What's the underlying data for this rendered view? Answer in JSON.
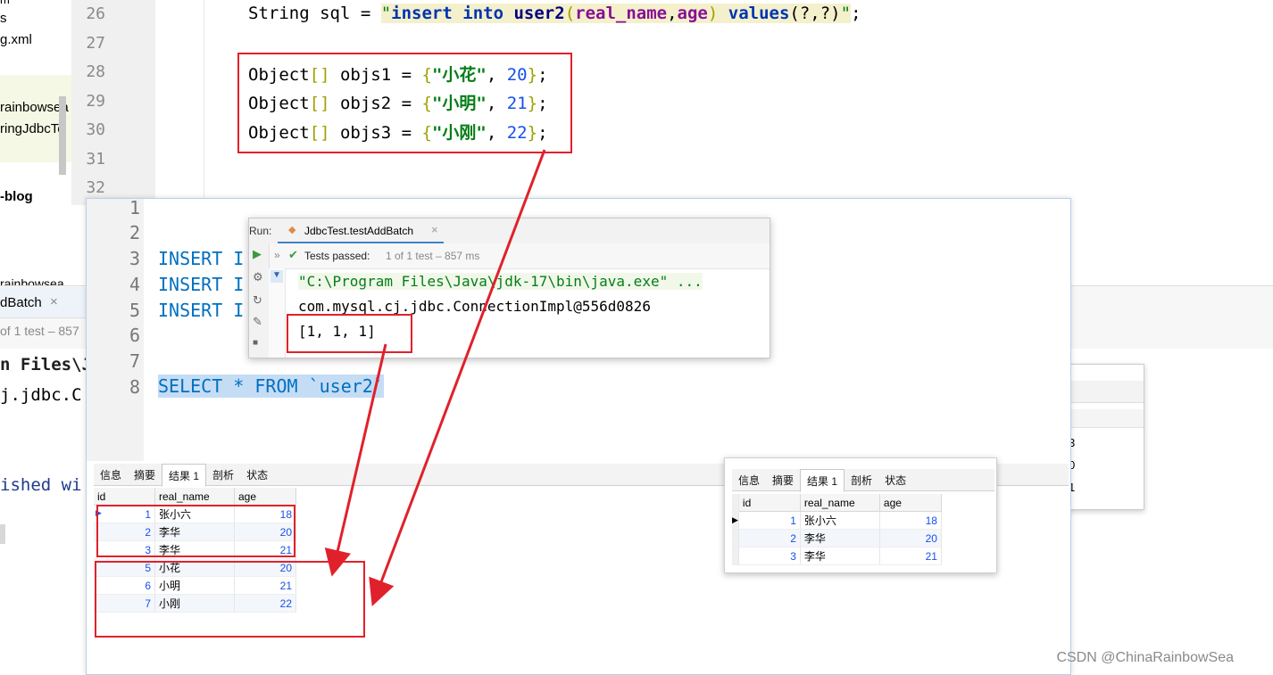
{
  "bg_project": {
    "items": [
      "m",
      "s",
      "g.xml",
      "rainbowsea",
      "ringJdbcTe",
      "-blog",
      "rainbowsea"
    ]
  },
  "bg_editor": {
    "line_numbers": [
      "26",
      "27",
      "28",
      "29",
      "30",
      "31",
      "32"
    ],
    "sql_line": {
      "prefix": "String sql = ",
      "q1": "\"",
      "kw_insert": "insert",
      "sp1": " ",
      "kw_into": "into",
      "sp2": " ",
      "table": "user2",
      "lp": "(",
      "col1": "real_name",
      "comma": ",",
      "col2": "age",
      "rp": ")",
      "sp3": " ",
      "kw_values": "values",
      "params": "(?,?)",
      "q2": "\"",
      "end": ";"
    },
    "obj_lines": [
      {
        "decl": "Object",
        "arr": "[]",
        "name": " objs1 = ",
        "lb": "{",
        "str": "\"小花\"",
        "sep": ", ",
        "num": "20",
        "rb": "}",
        "end": ";"
      },
      {
        "decl": "Object",
        "arr": "[]",
        "name": " objs2 = ",
        "lb": "{",
        "str": "\"小明\"",
        "sep": ", ",
        "num": "21",
        "rb": "}",
        "end": ";"
      },
      {
        "decl": "Object",
        "arr": "[]",
        "name": " objs3 = ",
        "lb": "{",
        "str": "\"小刚\"",
        "sep": ", ",
        "num": "22",
        "rb": "}",
        "end": ";"
      }
    ]
  },
  "bg_lower_left": {
    "tab_label": "dBatch",
    "status": "of 1 test – 857",
    "line1": "n Files\\J",
    "line2": "j.jdbc.C",
    "line3": "ished wi"
  },
  "bg_right_card": {
    "values": [
      "3",
      "0",
      "1"
    ]
  },
  "sql_editor": {
    "line_numbers": [
      "1",
      "2",
      "3",
      "4",
      "5",
      "6",
      "7",
      "8"
    ],
    "lines": [
      "",
      "",
      "INSERT I",
      "INSERT I",
      "INSERT I",
      "",
      "",
      "SELECT * FROM `user2`"
    ]
  },
  "run_panel": {
    "run_label": "Run:",
    "tab_title": "JdbcTest.testAddBatch",
    "close_glyph": "×",
    "expand_glyph": "»",
    "status_pass": "Tests passed:",
    "status_detail": "1 of 1 test – 857 ms",
    "output": [
      "\"C:\\Program Files\\Java\\jdk-17\\bin\\java.exe\" ...",
      "com.mysql.cj.jdbc.ConnectionImpl@556d0826",
      "[1, 1, 1]"
    ]
  },
  "result_tabs": [
    "信息",
    "摘要",
    "结果 1",
    "剖析",
    "状态"
  ],
  "result_columns": [
    "id",
    "real_name",
    "age"
  ],
  "result_main": [
    {
      "id": "1",
      "name": "张小六",
      "age": "18"
    },
    {
      "id": "2",
      "name": "李华",
      "age": "20"
    },
    {
      "id": "3",
      "name": "李华",
      "age": "21"
    },
    {
      "id": "5",
      "name": "小花",
      "age": "20"
    },
    {
      "id": "6",
      "name": "小明",
      "age": "21"
    },
    {
      "id": "7",
      "name": "小刚",
      "age": "22"
    }
  ],
  "result_before": [
    {
      "id": "1",
      "name": "张小六",
      "age": "18"
    },
    {
      "id": "2",
      "name": "李华",
      "age": "20"
    },
    {
      "id": "3",
      "name": "李华",
      "age": "21"
    }
  ],
  "colors": {
    "annotation_red": "#e0212b",
    "selection": "#c5dcf5",
    "sql_keyword": "#0070c0"
  },
  "watermark": "CSDN @ChinaRainbowSea"
}
